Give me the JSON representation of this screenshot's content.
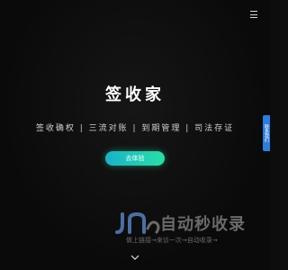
{
  "header": {
    "menu_icon": "menu-icon"
  },
  "hero": {
    "title": "签收家",
    "subtitle": "签收确权 | 三流对账 | 到期管理 | 司法存证",
    "cta_label": "去体验"
  },
  "side_tab": {
    "label": "联系我们"
  },
  "watermark": {
    "title": "自动秒收录",
    "subtitle": "做上链接→来访一次→自动收录→"
  },
  "scroll": {
    "icon": "chevron-down-icon"
  },
  "colors": {
    "background": "#0d0d0d",
    "cta_start": "#18b3c9",
    "cta_end": "#26e0a6",
    "side_tab": "#2b7de0",
    "watermark_logo": "#4a6fa5"
  }
}
